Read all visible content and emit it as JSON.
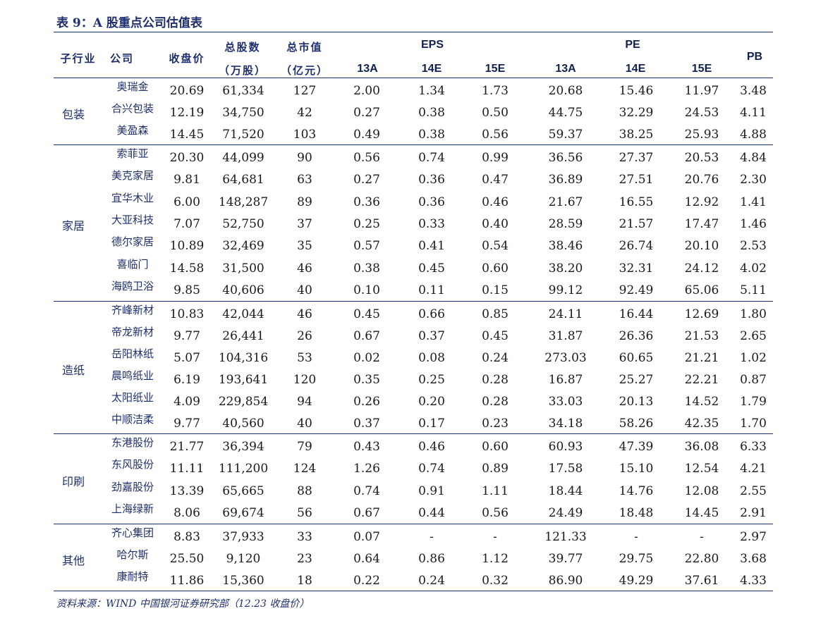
{
  "title": "表 9：A 股重点公司估值表",
  "header": {
    "industry": "子行业",
    "company": "公司",
    "price": "收盘价",
    "shares": "总股数",
    "shares_unit": "（万股）",
    "mktcap": "总市值",
    "mktcap_unit": "（亿元）",
    "eps": "EPS",
    "pe": "PE",
    "pb": "PB",
    "years": [
      "13A",
      "14E",
      "15E"
    ]
  },
  "groups": [
    {
      "industry": "包装",
      "rows": [
        {
          "company": "奥瑞金",
          "price": "20.69",
          "shares": "61,334",
          "mktcap": "127",
          "eps13": "2.00",
          "eps14": "1.34",
          "eps15": "1.73",
          "pe13": "20.68",
          "pe14": "15.46",
          "pe15": "11.97",
          "pb": "3.48"
        },
        {
          "company": "合兴包装",
          "price": "12.19",
          "shares": "34,750",
          "mktcap": "42",
          "eps13": "0.27",
          "eps14": "0.38",
          "eps15": "0.50",
          "pe13": "44.75",
          "pe14": "32.29",
          "pe15": "24.53",
          "pb": "4.11"
        },
        {
          "company": "美盈森",
          "price": "14.45",
          "shares": "71,520",
          "mktcap": "103",
          "eps13": "0.49",
          "eps14": "0.38",
          "eps15": "0.56",
          "pe13": "59.37",
          "pe14": "38.25",
          "pe15": "25.93",
          "pb": "4.88"
        }
      ]
    },
    {
      "industry": "家居",
      "rows": [
        {
          "company": "索菲亚",
          "price": "20.30",
          "shares": "44,099",
          "mktcap": "90",
          "eps13": "0.56",
          "eps14": "0.74",
          "eps15": "0.99",
          "pe13": "36.56",
          "pe14": "27.37",
          "pe15": "20.53",
          "pb": "4.84"
        },
        {
          "company": "美克家居",
          "price": "9.81",
          "shares": "64,681",
          "mktcap": "63",
          "eps13": "0.27",
          "eps14": "0.36",
          "eps15": "0.47",
          "pe13": "36.89",
          "pe14": "27.51",
          "pe15": "20.76",
          "pb": "2.30"
        },
        {
          "company": "宜华木业",
          "price": "6.00",
          "shares": "148,287",
          "mktcap": "89",
          "eps13": "0.36",
          "eps14": "0.36",
          "eps15": "0.46",
          "pe13": "21.67",
          "pe14": "16.55",
          "pe15": "12.92",
          "pb": "1.41"
        },
        {
          "company": "大亚科技",
          "price": "7.07",
          "shares": "52,750",
          "mktcap": "37",
          "eps13": "0.25",
          "eps14": "0.33",
          "eps15": "0.40",
          "pe13": "28.59",
          "pe14": "21.57",
          "pe15": "17.47",
          "pb": "1.46"
        },
        {
          "company": "德尔家居",
          "price": "10.89",
          "shares": "32,469",
          "mktcap": "35",
          "eps13": "0.57",
          "eps14": "0.41",
          "eps15": "0.54",
          "pe13": "38.46",
          "pe14": "26.74",
          "pe15": "20.10",
          "pb": "2.53"
        },
        {
          "company": "喜临门",
          "price": "14.58",
          "shares": "31,500",
          "mktcap": "46",
          "eps13": "0.38",
          "eps14": "0.45",
          "eps15": "0.60",
          "pe13": "38.20",
          "pe14": "32.31",
          "pe15": "24.12",
          "pb": "4.02"
        },
        {
          "company": "海鸥卫浴",
          "price": "9.85",
          "shares": "40,606",
          "mktcap": "40",
          "eps13": "0.10",
          "eps14": "0.11",
          "eps15": "0.15",
          "pe13": "99.12",
          "pe14": "92.49",
          "pe15": "65.06",
          "pb": "5.11"
        }
      ]
    },
    {
      "industry": "造纸",
      "rows": [
        {
          "company": "齐峰新材",
          "price": "10.83",
          "shares": "42,044",
          "mktcap": "46",
          "eps13": "0.45",
          "eps14": "0.66",
          "eps15": "0.85",
          "pe13": "24.11",
          "pe14": "16.44",
          "pe15": "12.69",
          "pb": "1.80"
        },
        {
          "company": "帝龙新材",
          "price": "9.77",
          "shares": "26,441",
          "mktcap": "26",
          "eps13": "0.67",
          "eps14": "0.37",
          "eps15": "0.45",
          "pe13": "31.87",
          "pe14": "26.36",
          "pe15": "21.53",
          "pb": "2.65"
        },
        {
          "company": "岳阳林纸",
          "price": "5.07",
          "shares": "104,316",
          "mktcap": "53",
          "eps13": "0.02",
          "eps14": "0.08",
          "eps15": "0.24",
          "pe13": "273.03",
          "pe14": "60.65",
          "pe15": "21.21",
          "pb": "1.02"
        },
        {
          "company": "晨鸣纸业",
          "price": "6.19",
          "shares": "193,641",
          "mktcap": "120",
          "eps13": "0.35",
          "eps14": "0.25",
          "eps15": "0.28",
          "pe13": "16.87",
          "pe14": "25.27",
          "pe15": "22.21",
          "pb": "0.87"
        },
        {
          "company": "太阳纸业",
          "price": "4.09",
          "shares": "229,854",
          "mktcap": "94",
          "eps13": "0.26",
          "eps14": "0.20",
          "eps15": "0.28",
          "pe13": "33.03",
          "pe14": "20.13",
          "pe15": "14.52",
          "pb": "1.79"
        },
        {
          "company": "中顺洁柔",
          "price": "9.77",
          "shares": "40,560",
          "mktcap": "40",
          "eps13": "0.37",
          "eps14": "0.17",
          "eps15": "0.23",
          "pe13": "34.18",
          "pe14": "58.26",
          "pe15": "42.35",
          "pb": "1.70"
        }
      ]
    },
    {
      "industry": "印刷",
      "rows": [
        {
          "company": "东港股份",
          "price": "21.77",
          "shares": "36,394",
          "mktcap": "79",
          "eps13": "0.43",
          "eps14": "0.46",
          "eps15": "0.60",
          "pe13": "60.93",
          "pe14": "47.39",
          "pe15": "36.08",
          "pb": "6.33"
        },
        {
          "company": "东风股份",
          "price": "11.11",
          "shares": "111,200",
          "mktcap": "124",
          "eps13": "1.26",
          "eps14": "0.74",
          "eps15": "0.89",
          "pe13": "17.58",
          "pe14": "15.10",
          "pe15": "12.54",
          "pb": "4.21"
        },
        {
          "company": "劲嘉股份",
          "price": "13.39",
          "shares": "65,665",
          "mktcap": "88",
          "eps13": "0.74",
          "eps14": "0.91",
          "eps15": "1.11",
          "pe13": "18.44",
          "pe14": "14.76",
          "pe15": "12.08",
          "pb": "2.55"
        },
        {
          "company": "上海绿新",
          "price": "8.06",
          "shares": "69,674",
          "mktcap": "56",
          "eps13": "0.67",
          "eps14": "0.44",
          "eps15": "0.56",
          "pe13": "24.49",
          "pe14": "18.48",
          "pe15": "14.45",
          "pb": "2.91"
        }
      ]
    },
    {
      "industry": "其他",
      "rows": [
        {
          "company": "齐心集团",
          "price": "8.83",
          "shares": "37,933",
          "mktcap": "33",
          "eps13": "0.07",
          "eps14": "-",
          "eps15": "-",
          "pe13": "121.33",
          "pe14": "-",
          "pe15": "-",
          "pb": "2.97"
        },
        {
          "company": "哈尔斯",
          "price": "25.50",
          "shares": "9,120",
          "mktcap": "23",
          "eps13": "0.64",
          "eps14": "0.86",
          "eps15": "1.12",
          "pe13": "39.77",
          "pe14": "29.75",
          "pe15": "22.80",
          "pb": "3.68"
        },
        {
          "company": "康耐特",
          "price": "11.86",
          "shares": "15,360",
          "mktcap": "18",
          "eps13": "0.22",
          "eps14": "0.24",
          "eps15": "0.32",
          "pe13": "86.90",
          "pe14": "49.29",
          "pe15": "37.61",
          "pb": "4.33"
        }
      ]
    }
  ],
  "source": "资料来源：WIND 中国银河证券研究部（12.23 收盘价）"
}
